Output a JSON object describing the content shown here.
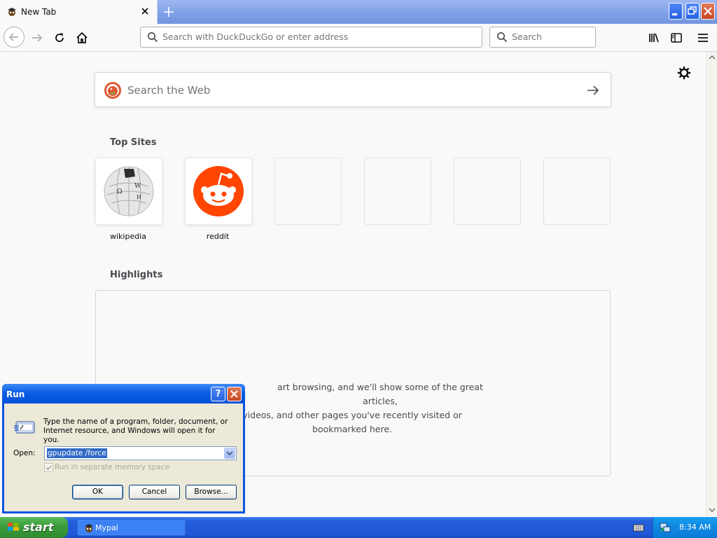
{
  "browser": {
    "tab_title": "New Tab",
    "url_placeholder": "Search with DuckDuckGo or enter address",
    "search_placeholder": "Search"
  },
  "newtab": {
    "web_search_placeholder": "Search the Web",
    "top_sites_title": "Top Sites",
    "top_sites": [
      {
        "label": "wikipedia",
        "icon": "wikipedia-logo"
      },
      {
        "label": "reddit",
        "icon": "reddit-logo"
      },
      {
        "label": "",
        "icon": ""
      },
      {
        "label": "",
        "icon": ""
      },
      {
        "label": "",
        "icon": ""
      },
      {
        "label": "",
        "icon": ""
      }
    ],
    "highlights_title": "Highlights",
    "highlights_message_lines": [
      "art browsing, and we'll show some of the great articles,",
      "videos, and other pages you've recently visited or",
      "bookmarked here."
    ]
  },
  "run_dialog": {
    "title": "Run",
    "help_label": "?",
    "description": "Type the name of a program, folder, document, or Internet resource, and Windows will open it for you.",
    "open_label": "Open:",
    "open_value": "gpupdate /force",
    "checkbox_label": "Run in separate memory space",
    "checkbox_checked": true,
    "ok_label": "OK",
    "cancel_label": "Cancel",
    "browse_label": "Browse..."
  },
  "taskbar": {
    "start_label": "start",
    "task_label": "Mypal",
    "clock": "8:34 AM"
  },
  "colors": {
    "xp_blue": "#245edb",
    "start_green": "#3c9e3c",
    "reddit_orange": "#ff4500",
    "ddg_orange": "#de5833"
  }
}
